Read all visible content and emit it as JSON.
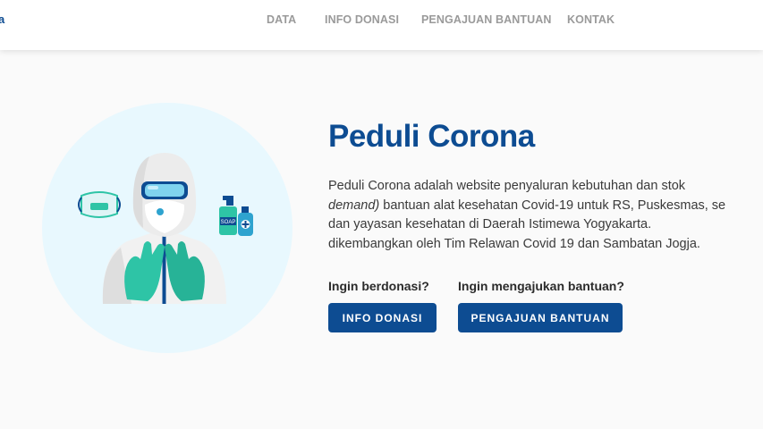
{
  "navbar": {
    "brand": "a",
    "links": [
      "DATA",
      "INFO DONASI",
      "PENGAJUAN BANTUAN",
      "KONTAK"
    ]
  },
  "hero": {
    "title": "Peduli Corona",
    "description": {
      "line1": "Peduli Corona adalah website penyaluran kebutuhan dan stok",
      "line2_em": "demand)",
      "line2_rest": " bantuan alat kesehatan Covid-19 untuk RS, Puskesmas, se",
      "line3": "dan yayasan kesehatan di Daerah Istimewa Yogyakarta.",
      "line4": "dikembangkan oleh Tim Relawan Covid 19 dan Sambatan Jogja."
    },
    "donate": {
      "question": "Ingin berdonasi?",
      "button": "INFO DONASI"
    },
    "request": {
      "question": "Ingin mengajukan bantuan?",
      "button": "PENGAJUAN BANTUAN"
    },
    "illustration": {
      "soap_label": "SOAP"
    }
  },
  "colors": {
    "primary": "#0d4c92",
    "nav_text": "#9a9a9a",
    "circle_bg": "#e8f8fe",
    "glove": "#2ec4a6"
  }
}
